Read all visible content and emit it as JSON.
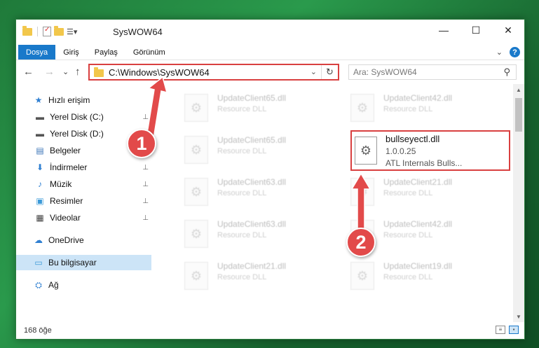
{
  "window": {
    "title": "SysWOW64",
    "controls": {
      "minimize": "—",
      "maximize": "☐",
      "close": "✕"
    }
  },
  "ribbon": {
    "tabs": [
      "Dosya",
      "Giriş",
      "Paylaş",
      "Görünüm"
    ],
    "collapse_glyph": "⌄",
    "help_glyph": "?"
  },
  "address": {
    "path": "C:\\Windows\\SysWOW64",
    "dropdown_glyph": "⌄",
    "refresh_glyph": "↻",
    "search_placeholder": "Ara: SysWOW64",
    "search_glyph": "⚲"
  },
  "nav": {
    "back": "←",
    "forward": "→",
    "recent": "⌄",
    "up": "↑"
  },
  "sidebar": {
    "items": [
      {
        "label": "Hızlı erişim",
        "icon": "star-icon",
        "glyph": "★",
        "color": "#2f7fd1",
        "pinned": false
      },
      {
        "label": "Yerel Disk (C:)",
        "icon": "drive-icon",
        "glyph": "▬",
        "color": "#555555",
        "pinned": true
      },
      {
        "label": "Yerel Disk (D:)",
        "icon": "drive-icon",
        "glyph": "▬",
        "color": "#555555",
        "pinned": false
      },
      {
        "label": "Belgeler",
        "icon": "documents-icon",
        "glyph": "▤",
        "color": "#3c76b8",
        "pinned": false
      },
      {
        "label": "İndirmeler",
        "icon": "download-icon",
        "glyph": "⬇",
        "color": "#2f7fd1",
        "pinned": true
      },
      {
        "label": "Müzik",
        "icon": "music-icon",
        "glyph": "♪",
        "color": "#2f7fd1",
        "pinned": true
      },
      {
        "label": "Resimler",
        "icon": "pictures-icon",
        "glyph": "▣",
        "color": "#3c9ad8",
        "pinned": true
      },
      {
        "label": "Videolar",
        "icon": "videos-icon",
        "glyph": "▦",
        "color": "#444444",
        "pinned": true
      },
      {
        "label": "OneDrive",
        "icon": "cloud-icon",
        "glyph": "☁",
        "color": "#2f7fd1",
        "pinned": false
      },
      {
        "label": "Bu bilgisayar",
        "icon": "computer-icon",
        "glyph": "▭",
        "color": "#3c9ad8",
        "pinned": false
      },
      {
        "label": "Ağ",
        "icon": "network-icon",
        "glyph": "⛭",
        "color": "#2f7fd1",
        "pinned": false
      }
    ],
    "pin_glyph": "📌"
  },
  "files": {
    "blurred": [
      {
        "name": "UpdateClient65.dll",
        "type": "Resource DLL"
      },
      {
        "name": "UpdateClient42.dll",
        "type": "Resource DLL"
      },
      {
        "name": "UpdateClient65.dll",
        "type": "Resource DLL"
      },
      {
        "name": "UpdateClient63.dll",
        "type": "Resource DLL"
      },
      {
        "name": "UpdateClient21.dll",
        "type": "Resource DLL"
      },
      {
        "name": "UpdateClient63.dll",
        "type": "Resource DLL"
      },
      {
        "name": "UpdateClient42.dll",
        "type": "Resource DLL"
      },
      {
        "name": "UpdateClient21.dll",
        "type": "Resource DLL"
      },
      {
        "name": "UpdateClient19.dll",
        "type": "Resource DLL"
      }
    ],
    "highlighted": {
      "name": "bullseyectl.dll",
      "version": "1.0.0.25",
      "description": "ATL Internals Bulls..."
    }
  },
  "statusbar": {
    "count": "168 öğe"
  },
  "annotations": {
    "badge1": "1",
    "badge2": "2",
    "color": "#e24a4a"
  }
}
